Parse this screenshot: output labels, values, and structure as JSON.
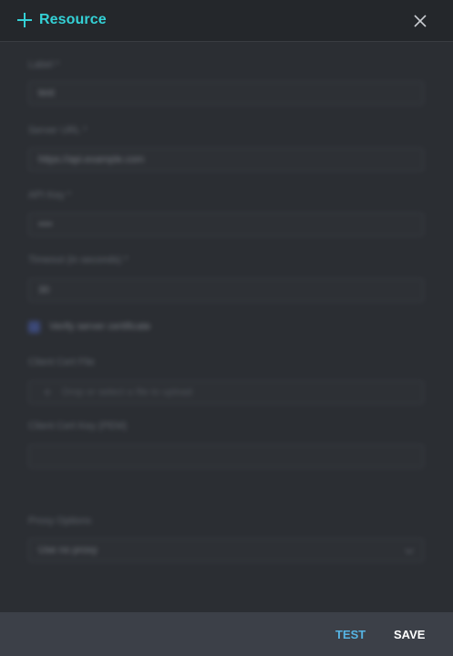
{
  "header": {
    "title": "Resource",
    "colors": {
      "accent": "#34d1d6"
    }
  },
  "form": {
    "label": {
      "label": "Label *",
      "value": "test"
    },
    "server_url": {
      "label": "Server URL *",
      "value": "https://api.example.com"
    },
    "api_key": {
      "label": "API Key *",
      "value": "••••"
    },
    "timeout": {
      "label": "Timeout (in seconds) *",
      "value": "30"
    },
    "verify_cert": {
      "label": "Verify server certificate",
      "checked": true
    },
    "client_cert": {
      "label": "Client Cert File",
      "placeholder": "Drop or select a file to upload"
    },
    "client_cert_key": {
      "label": "Client Cert Key (PEM)",
      "value": ""
    },
    "proxy": {
      "label": "Proxy Options",
      "value": "Use no proxy"
    }
  },
  "footer": {
    "test_label": "TEST",
    "save_label": "SAVE",
    "colors": {
      "test": "#56b4e3",
      "save": "#ffffff"
    }
  }
}
